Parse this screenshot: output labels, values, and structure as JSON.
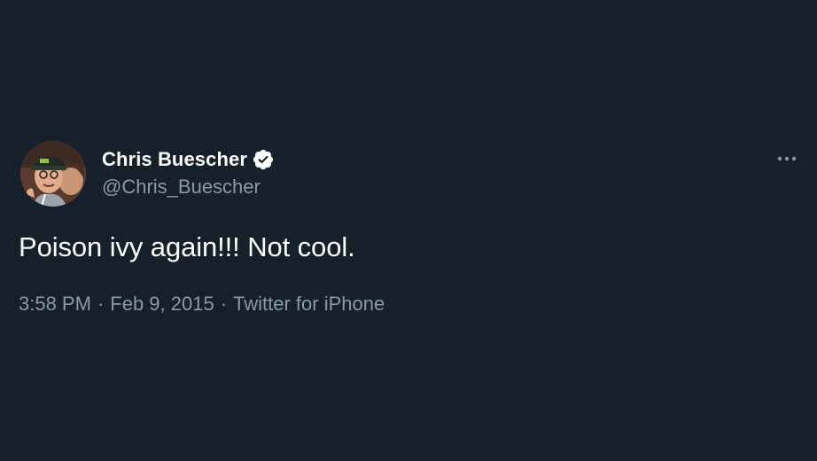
{
  "tweet": {
    "author": {
      "display_name": "Chris Buescher",
      "handle": "@Chris_Buescher",
      "verified": true,
      "avatar_icon": "profile-photo"
    },
    "text": "Poison ivy again!!! Not cool.",
    "meta": {
      "time": "3:58 PM",
      "date": "Feb 9, 2015",
      "source": "Twitter for iPhone",
      "separator": "·"
    },
    "more_icon": "more-horizontal-icon"
  },
  "colors": {
    "background": "#15202b",
    "primary_text": "#ffffff",
    "secondary_text": "#8b98a5"
  }
}
